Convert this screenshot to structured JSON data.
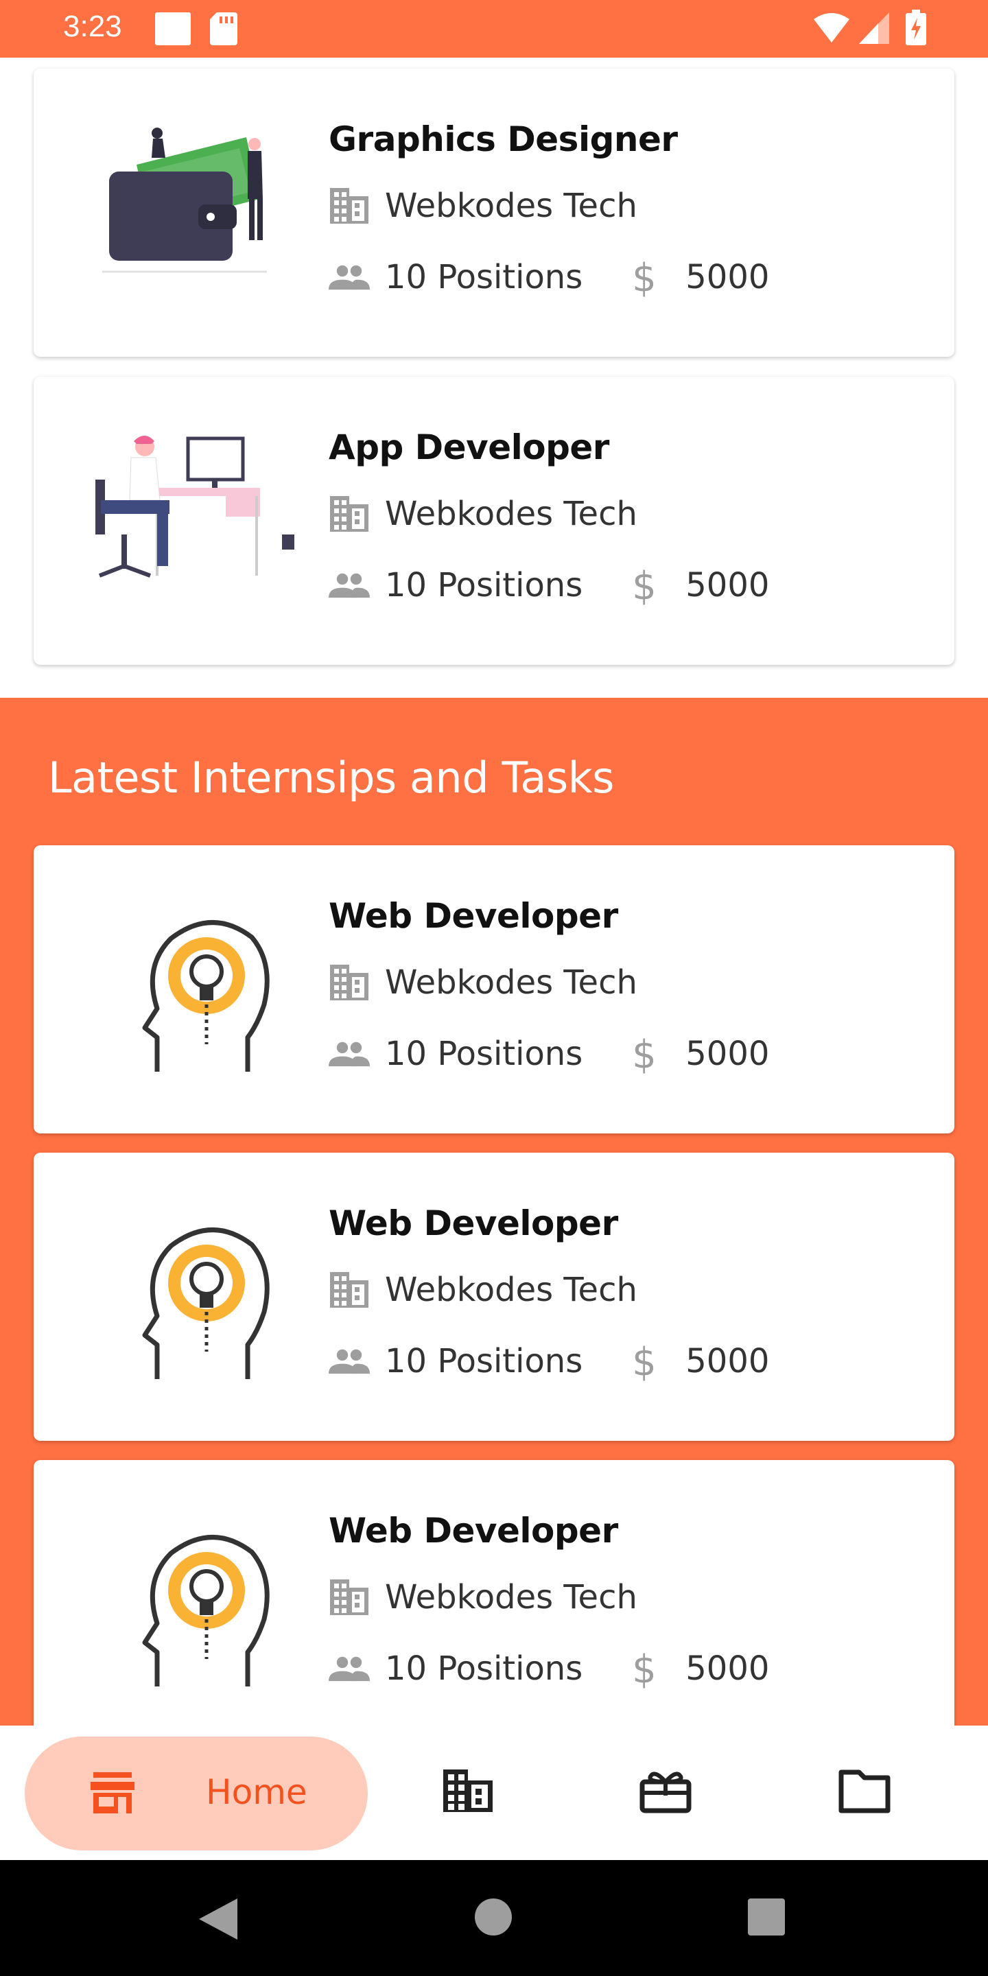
{
  "status_bar": {
    "time": "3:23"
  },
  "featured_jobs": [
    {
      "title": "Graphics Designer",
      "company": "Webkodes Tech",
      "positions": "10 Positions",
      "salary": "5000",
      "illustration": "wallet-illustration"
    },
    {
      "title": "App Developer",
      "company": "Webkodes Tech",
      "positions": "10 Positions",
      "salary": "5000",
      "illustration": "desk-illustration"
    }
  ],
  "internships": {
    "heading": "Latest Internsips and Tasks",
    "items": [
      {
        "title": "Web Developer",
        "company": "Webkodes Tech",
        "positions": "10 Positions",
        "salary": "5000",
        "illustration": "idea-head-illustration"
      },
      {
        "title": "Web Developer",
        "company": "Webkodes Tech",
        "positions": "10 Positions",
        "salary": "5000",
        "illustration": "idea-head-illustration"
      },
      {
        "title": "Web Developer",
        "company": "Webkodes Tech",
        "positions": "10 Positions",
        "salary": "5000",
        "illustration": "idea-head-illustration"
      }
    ]
  },
  "bottom_nav": {
    "active": "home",
    "home_label": "Home",
    "items": [
      "store-icon",
      "building-icon",
      "gift-icon",
      "folder-icon"
    ]
  },
  "colors": {
    "accent": "#FF7043",
    "nav_pill": "#FFCCBC",
    "nav_active_text": "#F4511E",
    "icon_gray": "#9e9e9e"
  }
}
